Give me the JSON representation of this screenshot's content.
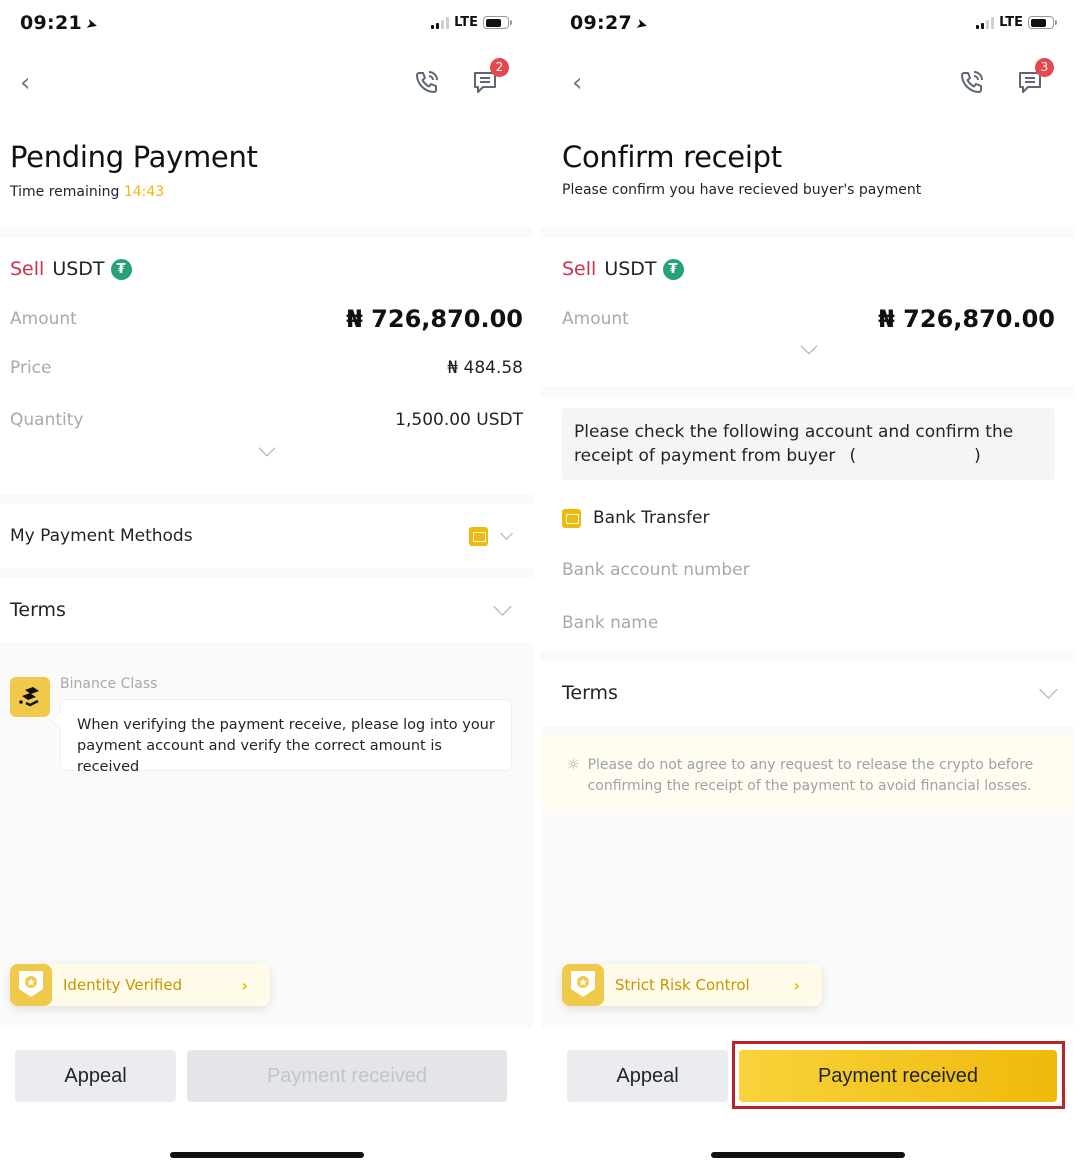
{
  "screens": [
    {
      "status_bar": {
        "time": "09:21",
        "network": "LTE"
      },
      "nav": {
        "back_icon": "chevron-left-icon",
        "call_icon": "phone-call-icon",
        "chat_icon": "chat-icon",
        "chat_badge": "2"
      },
      "header": {
        "title": "Pending Payment",
        "subtitle_prefix": "Time remaining",
        "timer": "14:43"
      },
      "order": {
        "side": "Sell",
        "asset": "USDT",
        "asset_icon": "tether-icon",
        "rows": [
          {
            "label": "Amount",
            "value": "₦ 726,870.00"
          },
          {
            "label": "Price",
            "value": "₦ 484.58"
          },
          {
            "label": "Quantity",
            "value": "1,500.00 USDT"
          }
        ]
      },
      "payment_methods": {
        "label": "My Payment Methods",
        "icon": "bank-card-icon"
      },
      "terms": {
        "label": "Terms"
      },
      "binance_class": {
        "name": "Binance Class",
        "message": "When verifying the payment receive, please log into your payment account and verify the correct amount is received"
      },
      "trust_badge": {
        "label": "Identity Verified",
        "icon": "shield-star-icon"
      },
      "buttons": {
        "appeal": "Appeal",
        "confirm": "Payment received",
        "confirm_enabled": false
      }
    },
    {
      "status_bar": {
        "time": "09:27",
        "network": "LTE"
      },
      "nav": {
        "back_icon": "chevron-left-icon",
        "call_icon": "phone-call-icon",
        "chat_icon": "chat-icon",
        "chat_badge": "3"
      },
      "header": {
        "title": "Confirm receipt",
        "subtitle": "Please confirm you have recieved buyer's payment"
      },
      "order": {
        "side": "Sell",
        "asset": "USDT",
        "asset_icon": "tether-icon",
        "rows": [
          {
            "label": "Amount",
            "value": "₦ 726,870.00"
          }
        ]
      },
      "check_notice": {
        "text_line1": "Please check the following account and confirm the",
        "text_line2": "receipt of payment from buyer",
        "buyer_open": "(",
        "buyer_close": ")"
      },
      "payment_method": {
        "name": "Bank Transfer",
        "icon": "bank-card-icon",
        "fields": [
          {
            "label": "Bank account number"
          },
          {
            "label": "Bank name"
          }
        ]
      },
      "terms": {
        "label": "Terms"
      },
      "warning": {
        "icon": "lightbulb-icon",
        "text": "Please do not agree to any request to release the crypto before confirming the receipt of the payment to avoid financial losses."
      },
      "trust_badge": {
        "label": "Strict Risk Control",
        "icon": "shield-star-icon"
      },
      "buttons": {
        "appeal": "Appeal",
        "confirm": "Payment received",
        "confirm_enabled": true,
        "highlighted": true
      }
    }
  ],
  "colors": {
    "brand_yellow": "#f0b90b",
    "sell_red": "#cf304a",
    "tether_green": "#26a17b",
    "badge_red": "#e5484d",
    "highlight_red": "#b5252a"
  }
}
